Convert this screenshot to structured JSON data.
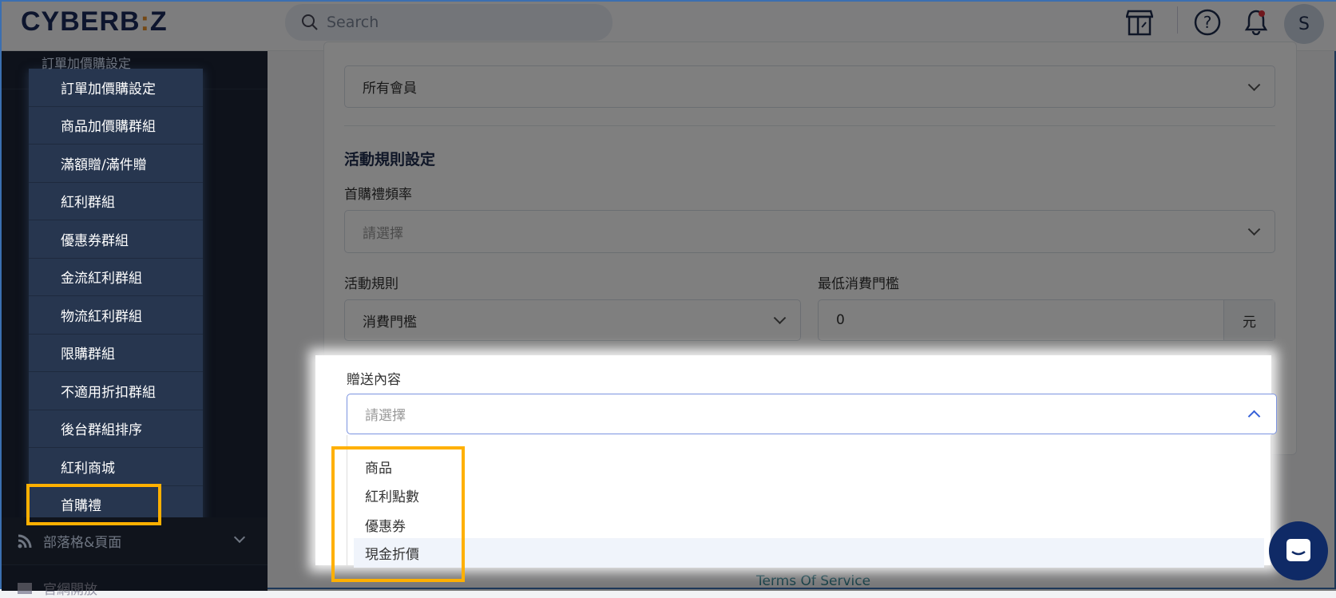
{
  "header": {
    "logo": "CYBERB:Z",
    "search_placeholder": "Search",
    "avatar_initial": "S"
  },
  "sidebar": {
    "hidden_item": "訂單加價購設定",
    "items": [
      {
        "label": "訂單加價購設定"
      },
      {
        "label": "商品加價購群組"
      },
      {
        "label": "滿額贈/滿件贈"
      },
      {
        "label": "紅利群組"
      },
      {
        "label": "優惠券群組"
      },
      {
        "label": "金流紅利群組"
      },
      {
        "label": "物流紅利群組"
      },
      {
        "label": "限購群組"
      },
      {
        "label": "不適用折扣群組"
      },
      {
        "label": "後台群組排序"
      },
      {
        "label": "紅利商城"
      },
      {
        "label": "首購禮",
        "selected": true
      }
    ],
    "blog_label": "部落格&頁面",
    "next_label": "官網開放"
  },
  "form": {
    "target_value": "所有會員",
    "section_title": "活動規則設定",
    "frequency_label": "首購禮頻率",
    "frequency_placeholder": "請選擇",
    "rule_label": "活動規則",
    "rule_value": "消費門檻",
    "min_label": "最低消費門檻",
    "min_value": "0",
    "min_unit": "元",
    "gift_label": "贈送內容",
    "gift_placeholder": "請選擇",
    "gift_options": [
      {
        "label": "商品"
      },
      {
        "label": "紅利點數"
      },
      {
        "label": "優惠券"
      },
      {
        "label": "現金折價",
        "hovered": true
      }
    ]
  },
  "footer": {
    "terms": "Terms Of Service"
  },
  "colors": {
    "highlight": "#ffb000",
    "sidebar": "#1c2536",
    "brand": "#1a2a5c"
  }
}
